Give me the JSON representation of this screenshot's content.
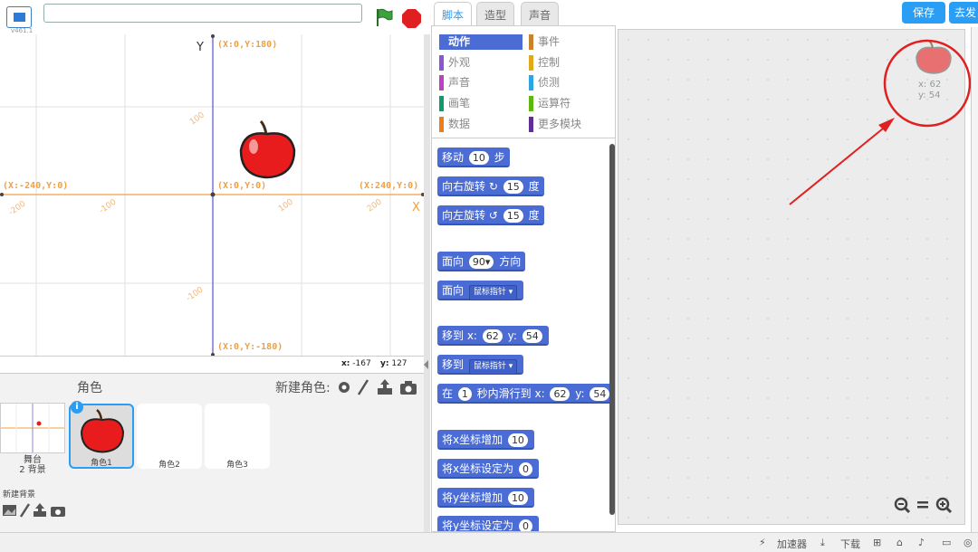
{
  "app": {
    "version": "v461.1",
    "project_title": ""
  },
  "tabs": [
    {
      "label": "脚本"
    },
    {
      "label": "造型"
    },
    {
      "label": "声音"
    }
  ],
  "header": {
    "save_label": "保存",
    "publish_label": "去发"
  },
  "stage": {
    "y_label": "Y",
    "x_label": "X",
    "coord_top": "(X:0,Y:180)",
    "coord_left": "(X:-240,Y:0)",
    "coord_center": "(X:0,Y:0)",
    "coord_right": "(X:240,Y:0)",
    "coord_bottom": "(X:0,Y:-180)",
    "tick_y_pos": "100",
    "tick_y_neg": "-100",
    "tick_x_m200": "-200",
    "tick_x_m100": "-100",
    "tick_x_p100": "100",
    "tick_x_p200": "200",
    "mouse_x_label": "x:",
    "mouse_x": "-167",
    "mouse_y_label": "y:",
    "mouse_y": "127"
  },
  "sprites": {
    "title": "角色",
    "new_sprite_label": "新建角色:",
    "stage_name": "舞台",
    "stage_backdrops": "2 背景",
    "new_backdrop_label": "新建背景",
    "items": [
      {
        "name": "角色1"
      },
      {
        "name": "角色2"
      },
      {
        "name": "角色3"
      }
    ],
    "info_glyph": "i"
  },
  "categories": [
    {
      "label": "动作",
      "color": "#4a6cd4"
    },
    {
      "label": "事件",
      "color": "#c88330"
    },
    {
      "label": "外观",
      "color": "#8a55d7"
    },
    {
      "label": "控制",
      "color": "#e1a91a"
    },
    {
      "label": "声音",
      "color": "#bb42c3"
    },
    {
      "label": "侦测",
      "color": "#2ca5e2"
    },
    {
      "label": "画笔",
      "color": "#0e9a6c"
    },
    {
      "label": "运算符",
      "color": "#5cb712"
    },
    {
      "label": "数据",
      "color": "#ee7d16"
    },
    {
      "label": "更多模块",
      "color": "#632d99"
    }
  ],
  "blocks": {
    "move_a": "移动",
    "move_val": "10",
    "move_b": "步",
    "turn_r_a": "向右旋转",
    "turn_r_val": "15",
    "turn_r_b": "度",
    "turn_l_a": "向左旋转",
    "turn_l_val": "15",
    "turn_l_b": "度",
    "point_dir_a": "面向",
    "point_dir_val": "90",
    "point_dir_b": "方向",
    "point_to_a": "面向",
    "point_to_val": "鼠标指针",
    "goto_xy_a": "移到 x:",
    "goto_xy_x": "62",
    "goto_xy_b": "y:",
    "goto_xy_y": "54",
    "goto_a": "移到",
    "goto_val": "鼠标指针",
    "glide_a": "在",
    "glide_t": "1",
    "glide_b": "秒内滑行到 x:",
    "glide_x": "62",
    "glide_c": "y:",
    "glide_y": "54",
    "change_x_a": "将x坐标增加",
    "change_x_val": "10",
    "set_x_a": "将x坐标设定为",
    "set_x_val": "0",
    "change_y_a": "将y坐标增加",
    "change_y_val": "10",
    "set_y_a": "将y坐标设定为",
    "set_y_val": "0"
  },
  "script_area": {
    "sprite_x": "x: 62",
    "sprite_y": "y: 54"
  },
  "statusbar": {
    "accelerator": "加速器",
    "download": "下载"
  },
  "colors": {
    "accent": "#2a9df4",
    "motion": "#4a6cd4",
    "annotation": "#e02020",
    "axis_x": "#f0a040",
    "axis_y": "#5555cc"
  }
}
